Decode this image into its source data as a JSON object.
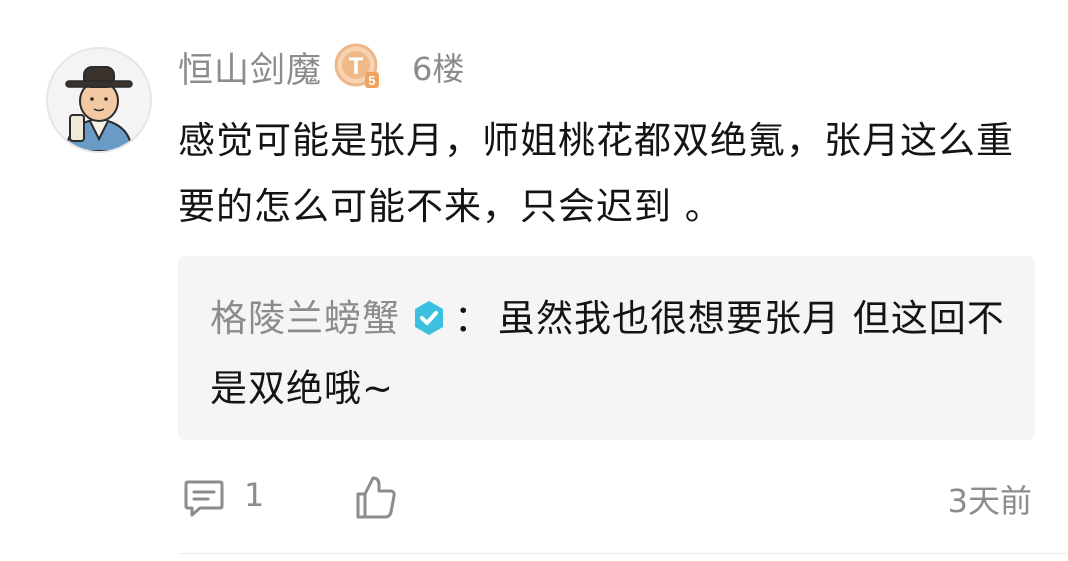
{
  "comment": {
    "username": "恒山剑魔",
    "level_badge": "T5",
    "floor": "6楼",
    "text": "感觉可能是张月，师姐桃花都双绝氪，张月这么重要的怎么可能不来，只会迟到 。",
    "reply": {
      "username": "格陵兰螃蟹",
      "separator": "：",
      "text": "虽然我也很想要张月 但这回不是双绝哦~"
    },
    "footer": {
      "reply_count": "1",
      "time": "3天前"
    }
  },
  "colors": {
    "secondary_text": "#8c8c8c",
    "primary_text": "#141414",
    "reply_bg": "#f5f5f5",
    "verified": "#3cc0e0",
    "badge": "#f0b98a"
  },
  "icons": {
    "avatar": "scholar-avatar",
    "level": "level-badge-icon",
    "verified": "verified-icon",
    "comment": "comment-icon",
    "like": "thumbs-up-icon"
  }
}
